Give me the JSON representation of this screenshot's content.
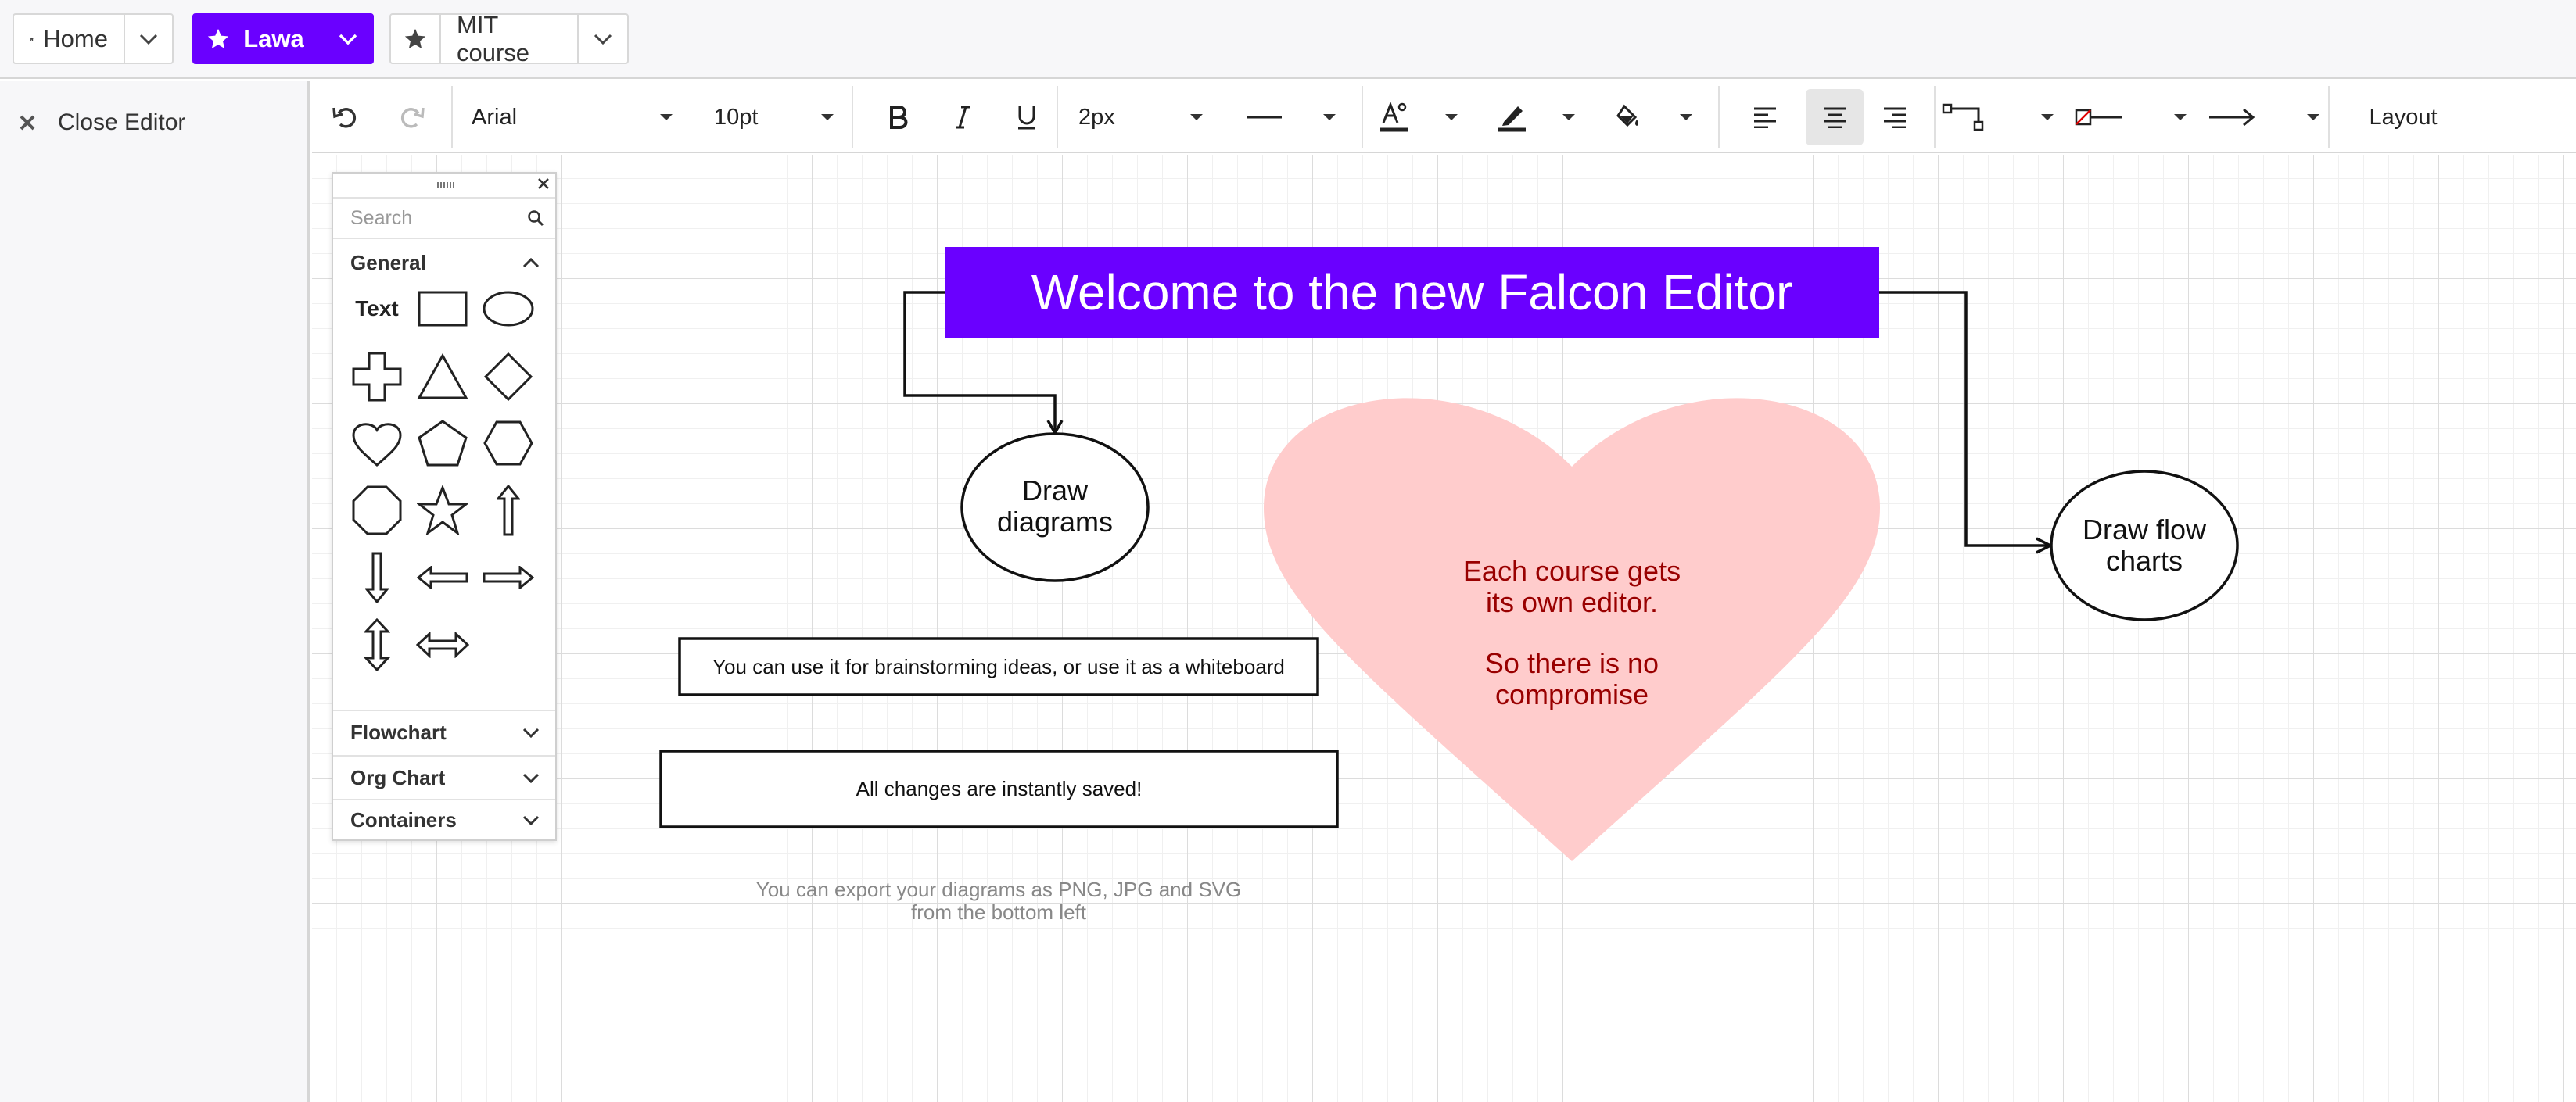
{
  "tabs": {
    "home": "Home",
    "lawa": "Lawa",
    "mit": "MIT course"
  },
  "sidebar": {
    "close_editor": "Close Editor"
  },
  "toolbar": {
    "font_family": "Arial",
    "font_size": "10pt",
    "stroke_width": "2px",
    "layout": "Layout",
    "accent_color": "#6a00ff"
  },
  "palette": {
    "search_placeholder": "Search",
    "general": "General",
    "text_tool": "Text",
    "flowchart": "Flowchart",
    "org_chart": "Org Chart",
    "containers": "Containers"
  },
  "diagram": {
    "title": "Welcome to the new Falcon Editor",
    "draw_diagrams_1": "Draw",
    "draw_diagrams_2": "diagrams",
    "draw_flow_1": "Draw flow",
    "draw_flow_2": "charts",
    "heart_1": "Each course gets",
    "heart_2": "its own editor.",
    "heart_3": "So there is no",
    "heart_4": "compromise",
    "brainstorm": "You can use it for brainstorming ideas, or use it as a whiteboard",
    "saved": "All changes are instantly saved!",
    "export_1": "You can export your diagrams as PNG, JPG and SVG",
    "export_2": "from the bottom left",
    "title_bg": "#6a00ff",
    "heart_fill": "#ffcccc",
    "heart_text": "#990000"
  }
}
